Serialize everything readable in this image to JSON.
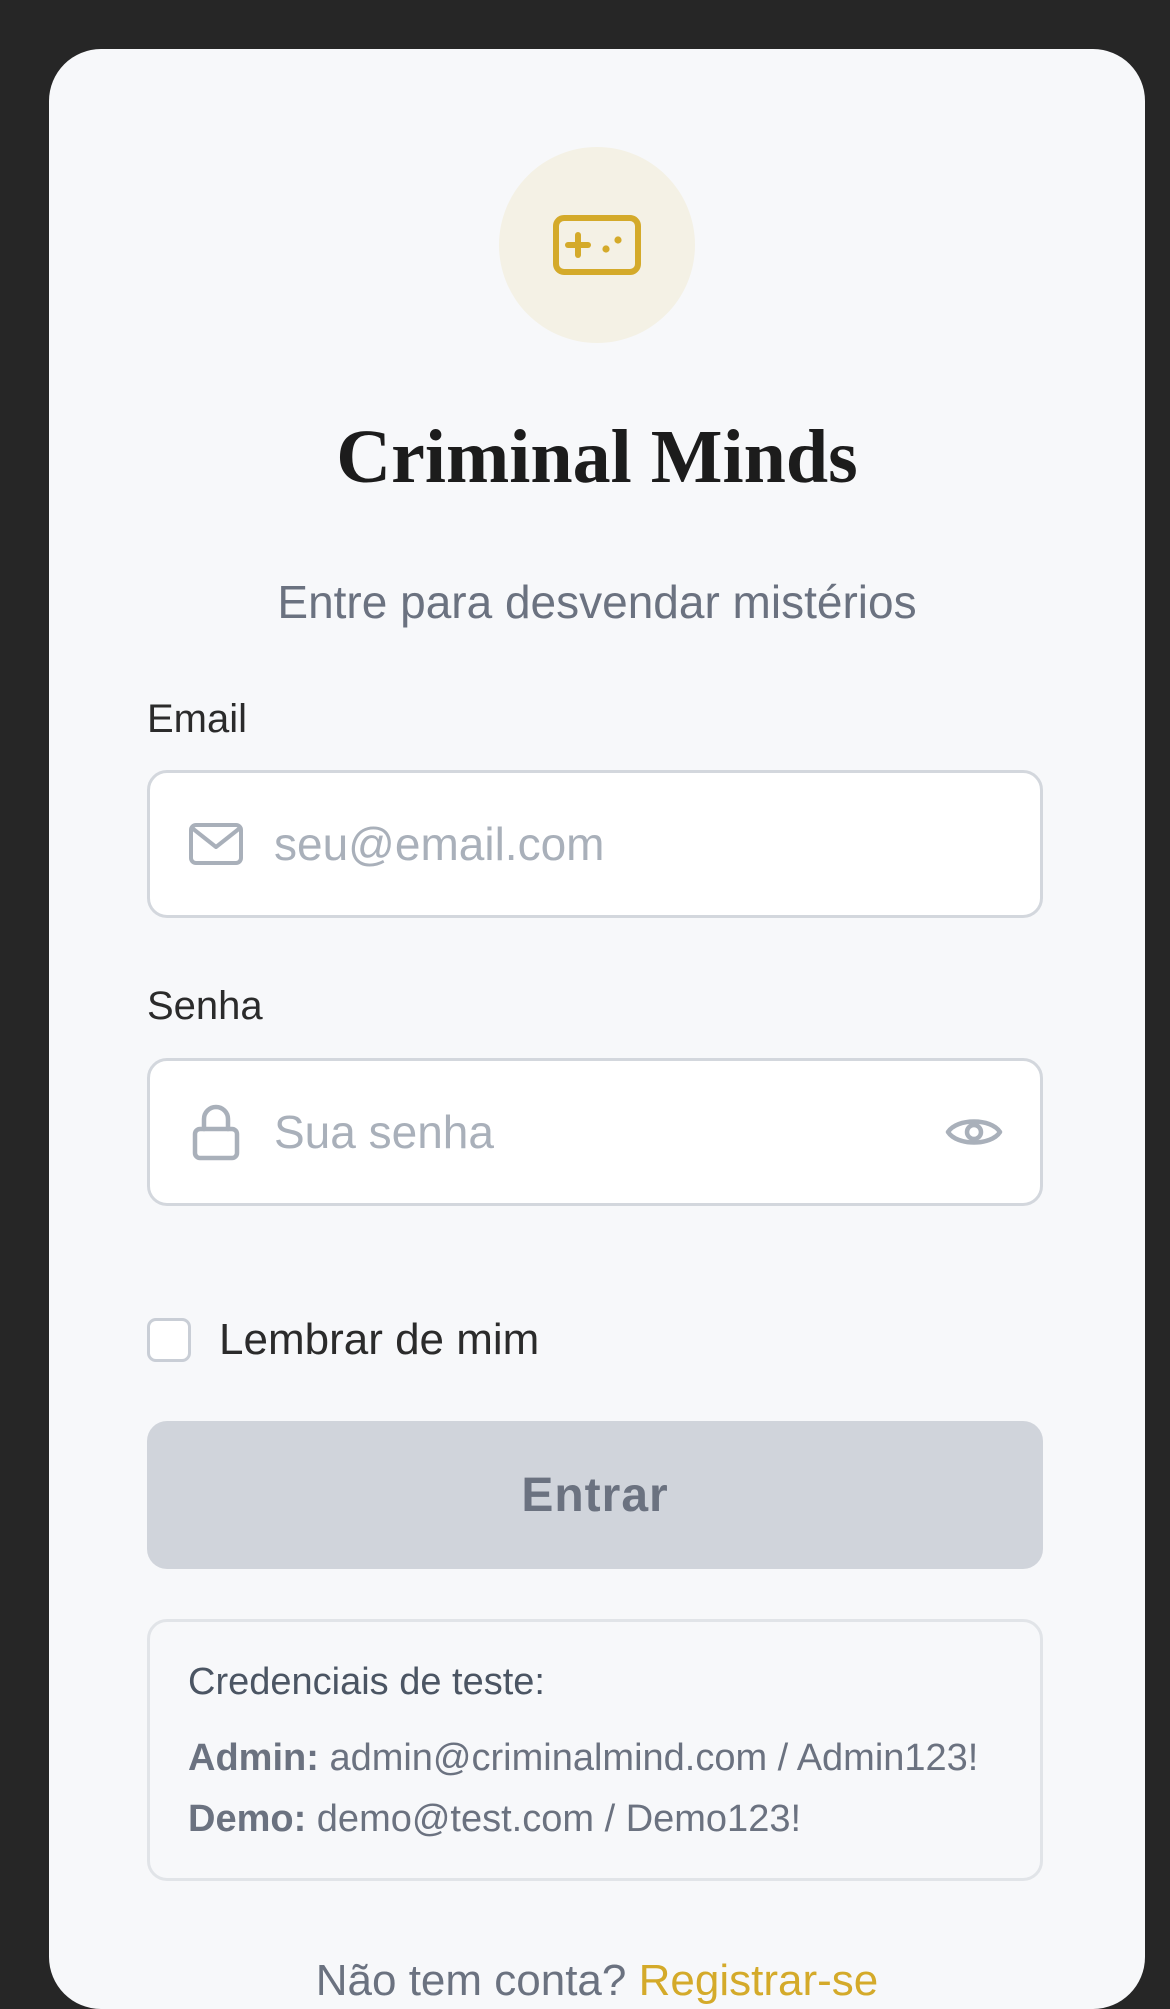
{
  "app": {
    "title": "Criminal Minds",
    "subtitle": "Entre para desvendar mistérios",
    "logo_icon": "gamepad-icon",
    "accent_color": "#d4aa2a"
  },
  "form": {
    "email_label": "Email",
    "email_placeholder": "seu@email.com",
    "email_value": "",
    "email_icon": "mail-icon",
    "password_label": "Senha",
    "password_placeholder": "Sua senha",
    "password_value": "",
    "password_icon": "lock-icon",
    "toggle_visibility_icon": "eye-icon",
    "remember_label": "Lembrar de mim",
    "remember_checked": false,
    "submit_label": "Entrar"
  },
  "test_credentials": {
    "title": "Credenciais de teste:",
    "items": [
      {
        "role": "Admin:",
        "value": "admin@criminalmind.com / Admin123!"
      },
      {
        "role": "Demo:",
        "value": "demo@test.com / Demo123!"
      }
    ]
  },
  "footer": {
    "text": "Não tem conta?",
    "link_label": "Registrar-se"
  }
}
